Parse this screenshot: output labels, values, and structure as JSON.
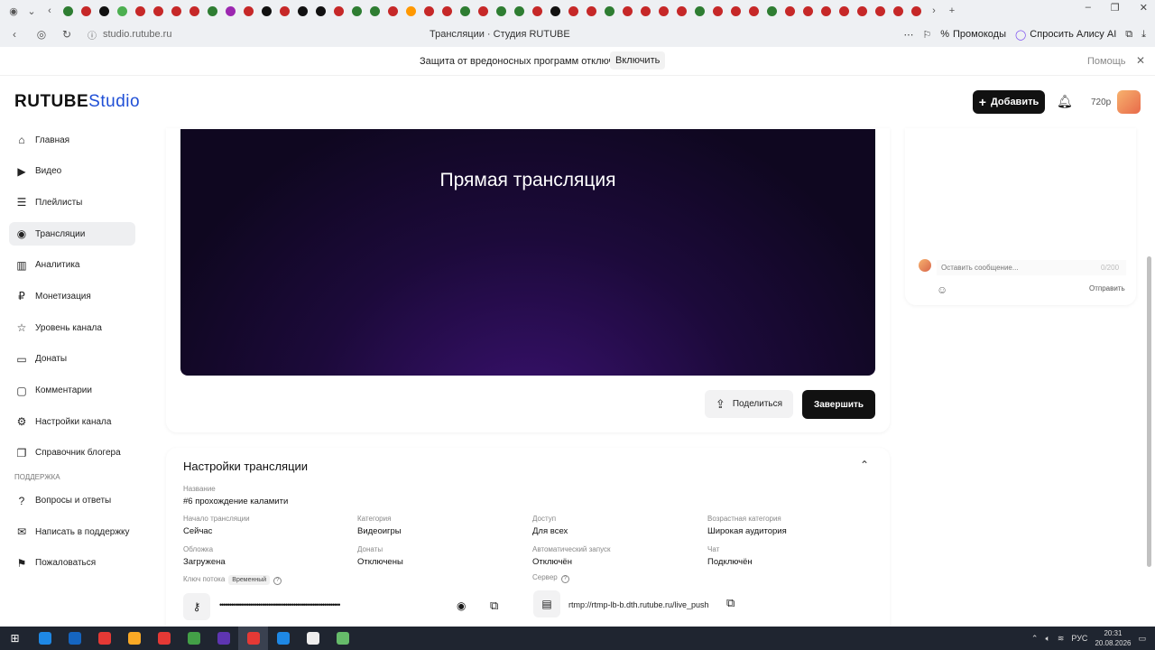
{
  "browser": {
    "tab_icons": [
      "#2e7d32",
      "#c62828",
      "#111111",
      "#4caf50",
      "#c62828",
      "#c62828",
      "#c62828",
      "#c62828",
      "#2e7d32",
      "#9c27b0",
      "#c62828",
      "#111111",
      "#c62828",
      "#111111",
      "#111111",
      "#c62828",
      "#2e7d32",
      "#2e7d32",
      "#c62828",
      "#ff9800",
      "#c62828",
      "#c62828",
      "#2e7d32",
      "#c62828",
      "#2e7d32",
      "#2e7d32",
      "#c62828",
      "#111111",
      "#c62828",
      "#c62828",
      "#2e7d32",
      "#c62828",
      "#c62828",
      "#c62828",
      "#c62828",
      "#2e7d32",
      "#c62828",
      "#c62828",
      "#c62828",
      "#2e7d32",
      "#c62828",
      "#c62828",
      "#c62828",
      "#c62828",
      "#c62828",
      "#c62828",
      "#c62828",
      "#c62828"
    ],
    "url": "studio.rutube.ru",
    "tab_title": "Трансляции · Студия RUTUBE",
    "promo_label": "Промокоды",
    "alice_label": "Спросить Алису AI"
  },
  "banner": {
    "message": "Защита от вредоносных программ отключена",
    "enable_label": "Включить",
    "help_label": "Помощь"
  },
  "header": {
    "logo_main": "RUTUBE",
    "logo_studio": "Studio",
    "add_label": "Добавить",
    "quality": "720p"
  },
  "sidebar": {
    "items": [
      {
        "label": "Главная",
        "icon": "home-icon"
      },
      {
        "label": "Видео",
        "icon": "video-icon"
      },
      {
        "label": "Плейлисты",
        "icon": "playlist-icon"
      },
      {
        "label": "Трансляции",
        "icon": "broadcast-icon"
      },
      {
        "label": "Аналитика",
        "icon": "analytics-icon"
      },
      {
        "label": "Монетизация",
        "icon": "monetization-icon"
      },
      {
        "label": "Уровень канала",
        "icon": "star-icon"
      },
      {
        "label": "Донаты",
        "icon": "donate-icon"
      },
      {
        "label": "Комментарии",
        "icon": "comment-icon"
      },
      {
        "label": "Настройки канала",
        "icon": "gear-icon"
      },
      {
        "label": "Справочник блогера",
        "icon": "book-icon"
      }
    ],
    "support_title": "ПОДДЕРЖКА",
    "support_items": [
      {
        "label": "Вопросы и ответы",
        "icon": "question-icon"
      },
      {
        "label": "Написать в поддержку",
        "icon": "mail-icon"
      },
      {
        "label": "Пожаловаться",
        "icon": "flag-icon"
      }
    ]
  },
  "player": {
    "title": "Прямая трансляция",
    "share_label": "Поделиться",
    "finish_label": "Завершить"
  },
  "chat": {
    "placeholder": "Оставить сообщение...",
    "counter": "0/200",
    "send_label": "Отправить"
  },
  "settings": {
    "title": "Настройки трансляции",
    "name_label": "Название",
    "name_value": "#6 прохождение каламити",
    "start_label": "Начало трансляции",
    "start_value": "Сейчас",
    "category_label": "Категория",
    "category_value": "Видеоигры",
    "access_label": "Доступ",
    "access_value": "Для всех",
    "age_label": "Возрастная категория",
    "age_value": "Широкая аудитория",
    "cover_label": "Обложка",
    "cover_value": "Загружена",
    "donates_label": "Донаты",
    "donates_value": "Отключены",
    "autostart_label": "Автоматический запуск",
    "autostart_value": "Отключён",
    "chat_label": "Чат",
    "chat_value": "Подключён",
    "key_label": "Ключ потока",
    "key_badge": "Временный",
    "key_value": "••••••••••••••••••••••••••••••••••••••••••••••••••••••••••••••",
    "server_label": "Сервер",
    "server_value": "rtmp://rtmp-lb-b.dth.rutube.ru/live_push"
  },
  "taskbar": {
    "apps": [
      "#1e88e5",
      "#1565c0",
      "#e53935",
      "#f9a825",
      "#e53935",
      "#43a047",
      "#5e35b1",
      "#e53935",
      "#1e88e5",
      "#eeeeee",
      "#66bb6a"
    ],
    "lang": "РУС",
    "time": "20:31",
    "date": "20.08.2026"
  }
}
